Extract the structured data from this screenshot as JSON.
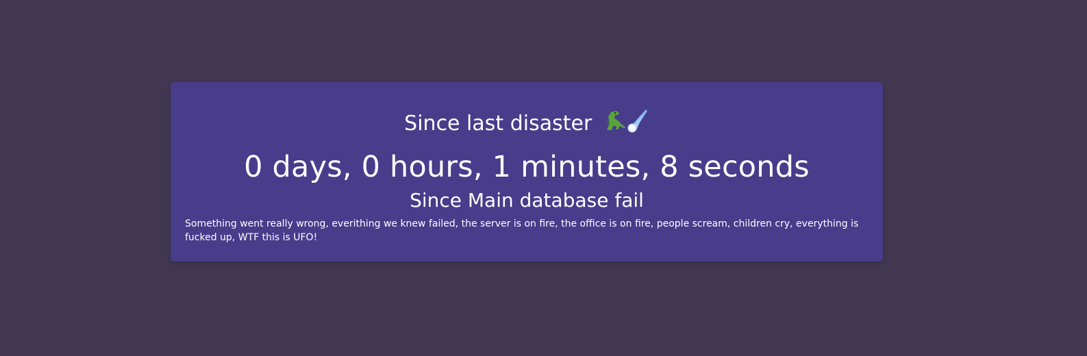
{
  "disaster": {
    "heading": "Since last disaster",
    "heading_icons": [
      "dinosaur-icon",
      "comet-icon"
    ],
    "elapsed": "0 days, 0 hours, 1 minutes, 8 seconds",
    "event_title": "Since Main database fail",
    "description": "Something went really wrong, everithing we knew failed, the server is on fire, the office is on fire, people scream, children cry, everything is fucked up, WTF this is UFO!"
  },
  "colors": {
    "background": "#413750",
    "card": "#483c8b",
    "text": "#ffffff"
  }
}
